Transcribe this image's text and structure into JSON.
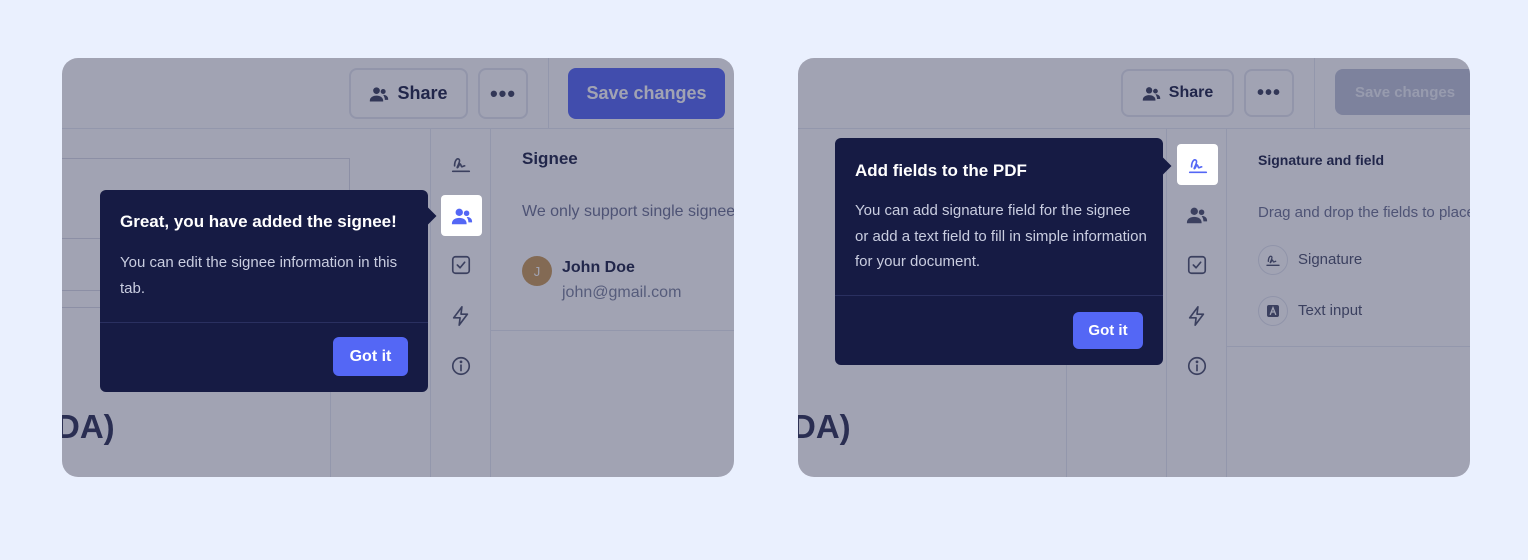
{
  "screen_a": {
    "toolbar": {
      "share_label": "Share",
      "save_label": "Save changes"
    },
    "panel": {
      "title": "Signee",
      "description": "We only support single signee",
      "signee": {
        "avatar_initial": "J",
        "name": "John Doe",
        "email": "john@gmail.com"
      }
    },
    "document_text": "DA)",
    "tooltip": {
      "title": "Great, you have added the signee!",
      "body": "You can edit the signee information in this tab.",
      "button": "Got it"
    }
  },
  "screen_b": {
    "toolbar": {
      "share_label": "Share",
      "save_label": "Save changes"
    },
    "panel": {
      "title": "Signature and field",
      "description": "Drag and drop the fields to place",
      "fields": [
        {
          "label": "Signature",
          "icon": "signature-icon"
        },
        {
          "label": "Text input",
          "icon": "text-input-icon"
        }
      ]
    },
    "document_text": "DA)",
    "tooltip": {
      "title": "Add fields to the PDF",
      "body": "You can add signature field for the signee or add a text field to fill in simple information for your document.",
      "button": "Got it"
    }
  },
  "colors": {
    "primary": "#5467f5",
    "tooltip_bg": "#161b44",
    "page_bg": "#eaf0fe",
    "avatar": "#c99a56"
  }
}
